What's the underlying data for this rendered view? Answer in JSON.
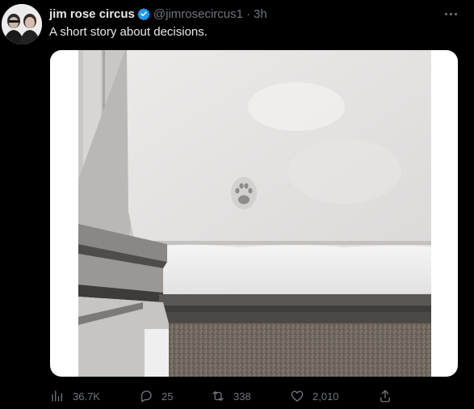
{
  "tweet": {
    "author_name": "jim rose circus",
    "handle": "@jimrosecircus1",
    "separator": "·",
    "time": "3h",
    "text": "A short story about decisions.",
    "image_alt": "Cat paw print in snow on the side of a building"
  },
  "actions": {
    "views": "36.7K",
    "replies": "25",
    "retweets": "338",
    "likes": "2,010"
  },
  "icons": {
    "verified": "verified-badge-icon",
    "more": "more-options-icon",
    "views": "analytics-icon",
    "reply": "reply-icon",
    "retweet": "retweet-icon",
    "like": "heart-icon",
    "share": "share-icon"
  },
  "colors": {
    "background": "#000000",
    "text_primary": "#e7e9ea",
    "text_secondary": "#71767b",
    "verified_blue": "#1d9bf0"
  }
}
